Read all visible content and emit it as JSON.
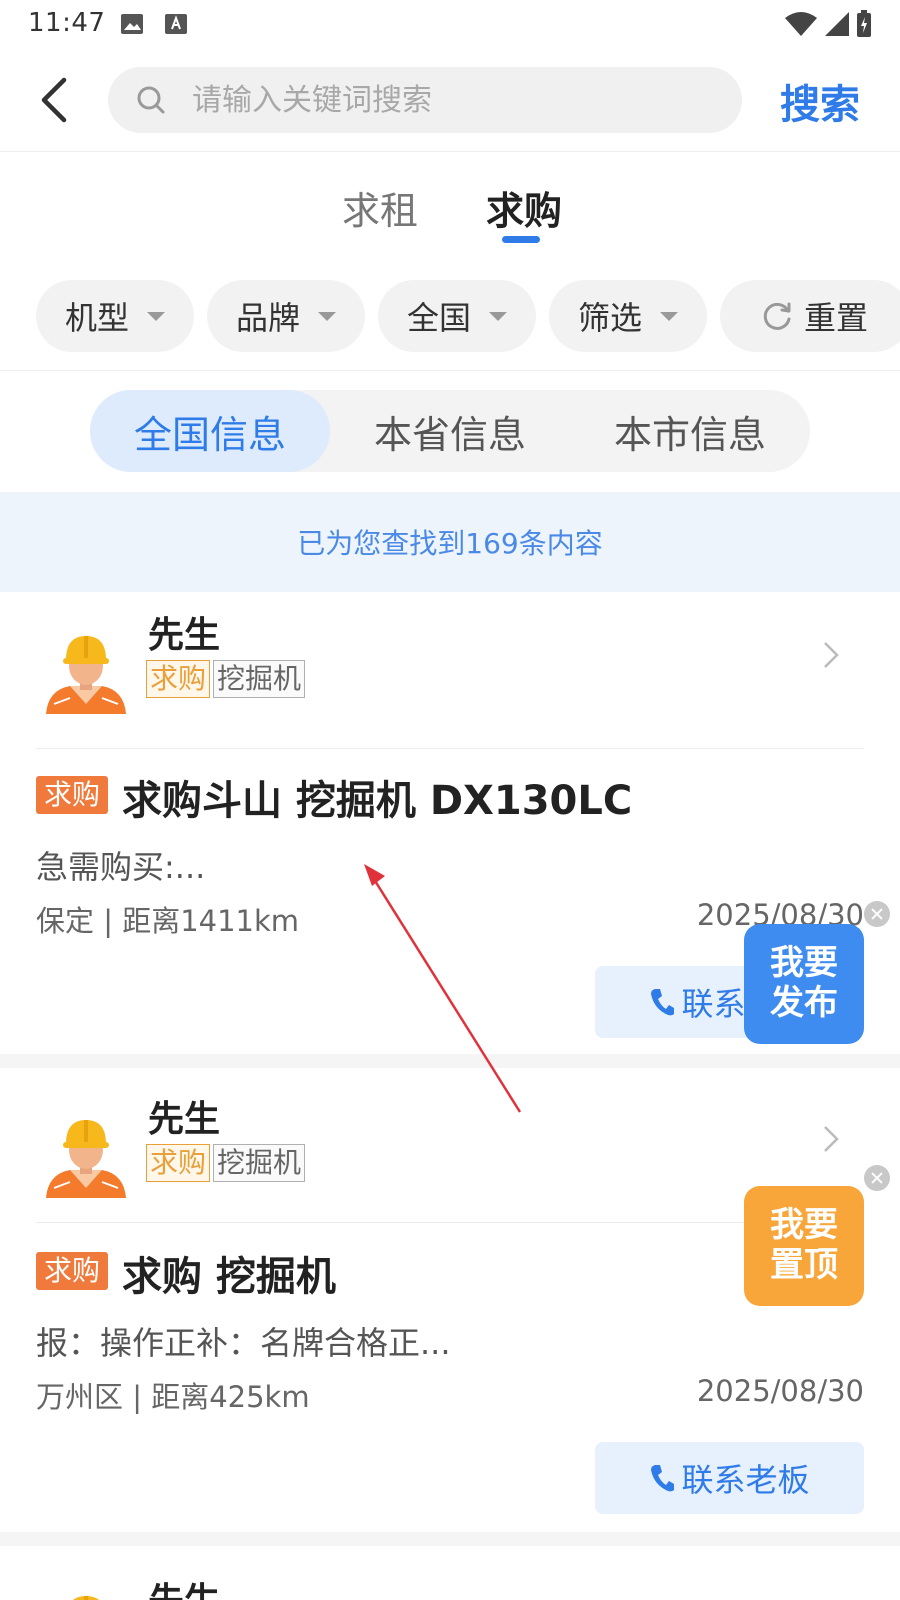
{
  "status_bar": {
    "time": "11:47",
    "icons": [
      "image-icon",
      "font-icon",
      "wifi-icon",
      "signal-icon",
      "battery-icon"
    ]
  },
  "header": {
    "back_icon": "back-arrow-icon",
    "search_placeholder": "请输入关键词搜索",
    "search_value": "",
    "search_button": "搜索"
  },
  "main_tabs": [
    {
      "label": "求租",
      "active": false
    },
    {
      "label": "求购",
      "active": true
    }
  ],
  "filters": [
    {
      "label": "机型"
    },
    {
      "label": "品牌"
    },
    {
      "label": "全国"
    },
    {
      "label": "筛选"
    }
  ],
  "reset_label": "重置",
  "region_tabs": [
    {
      "label": "全国信息",
      "active": true
    },
    {
      "label": "本省信息",
      "active": false
    },
    {
      "label": "本市信息",
      "active": false
    }
  ],
  "result_text": "已为您查找到169条内容",
  "listings": [
    {
      "name": "先生",
      "type_tag": "求购",
      "category_tag": "挖掘机",
      "badge": "求购",
      "title": "求购斗山 挖掘机 DX130LC",
      "description": "急需购买:...",
      "location": "保定 | 距离1411km",
      "date": "2025/08/30",
      "contact_label": "联系老板"
    },
    {
      "name": "先生",
      "type_tag": "求购",
      "category_tag": "挖掘机",
      "badge": "求购",
      "title": "求购 挖掘机",
      "description": "报：操作正补：名牌合格正...",
      "location": "万州区 | 距离425km",
      "date": "2025/08/30",
      "contact_label": "联系老板"
    },
    {
      "name": "先生"
    }
  ],
  "floating": {
    "publish_line1": "我要",
    "publish_line2": "发布",
    "top_line1": "我要",
    "top_line2": "置顶"
  },
  "colors": {
    "accent": "#2f7be8",
    "badge_orange": "#f07a3c",
    "tag_gold": "#e9a03a",
    "publish_blue": "#3f8cf0",
    "top_orange": "#f8a53a",
    "annotation_red": "#e0323a"
  }
}
